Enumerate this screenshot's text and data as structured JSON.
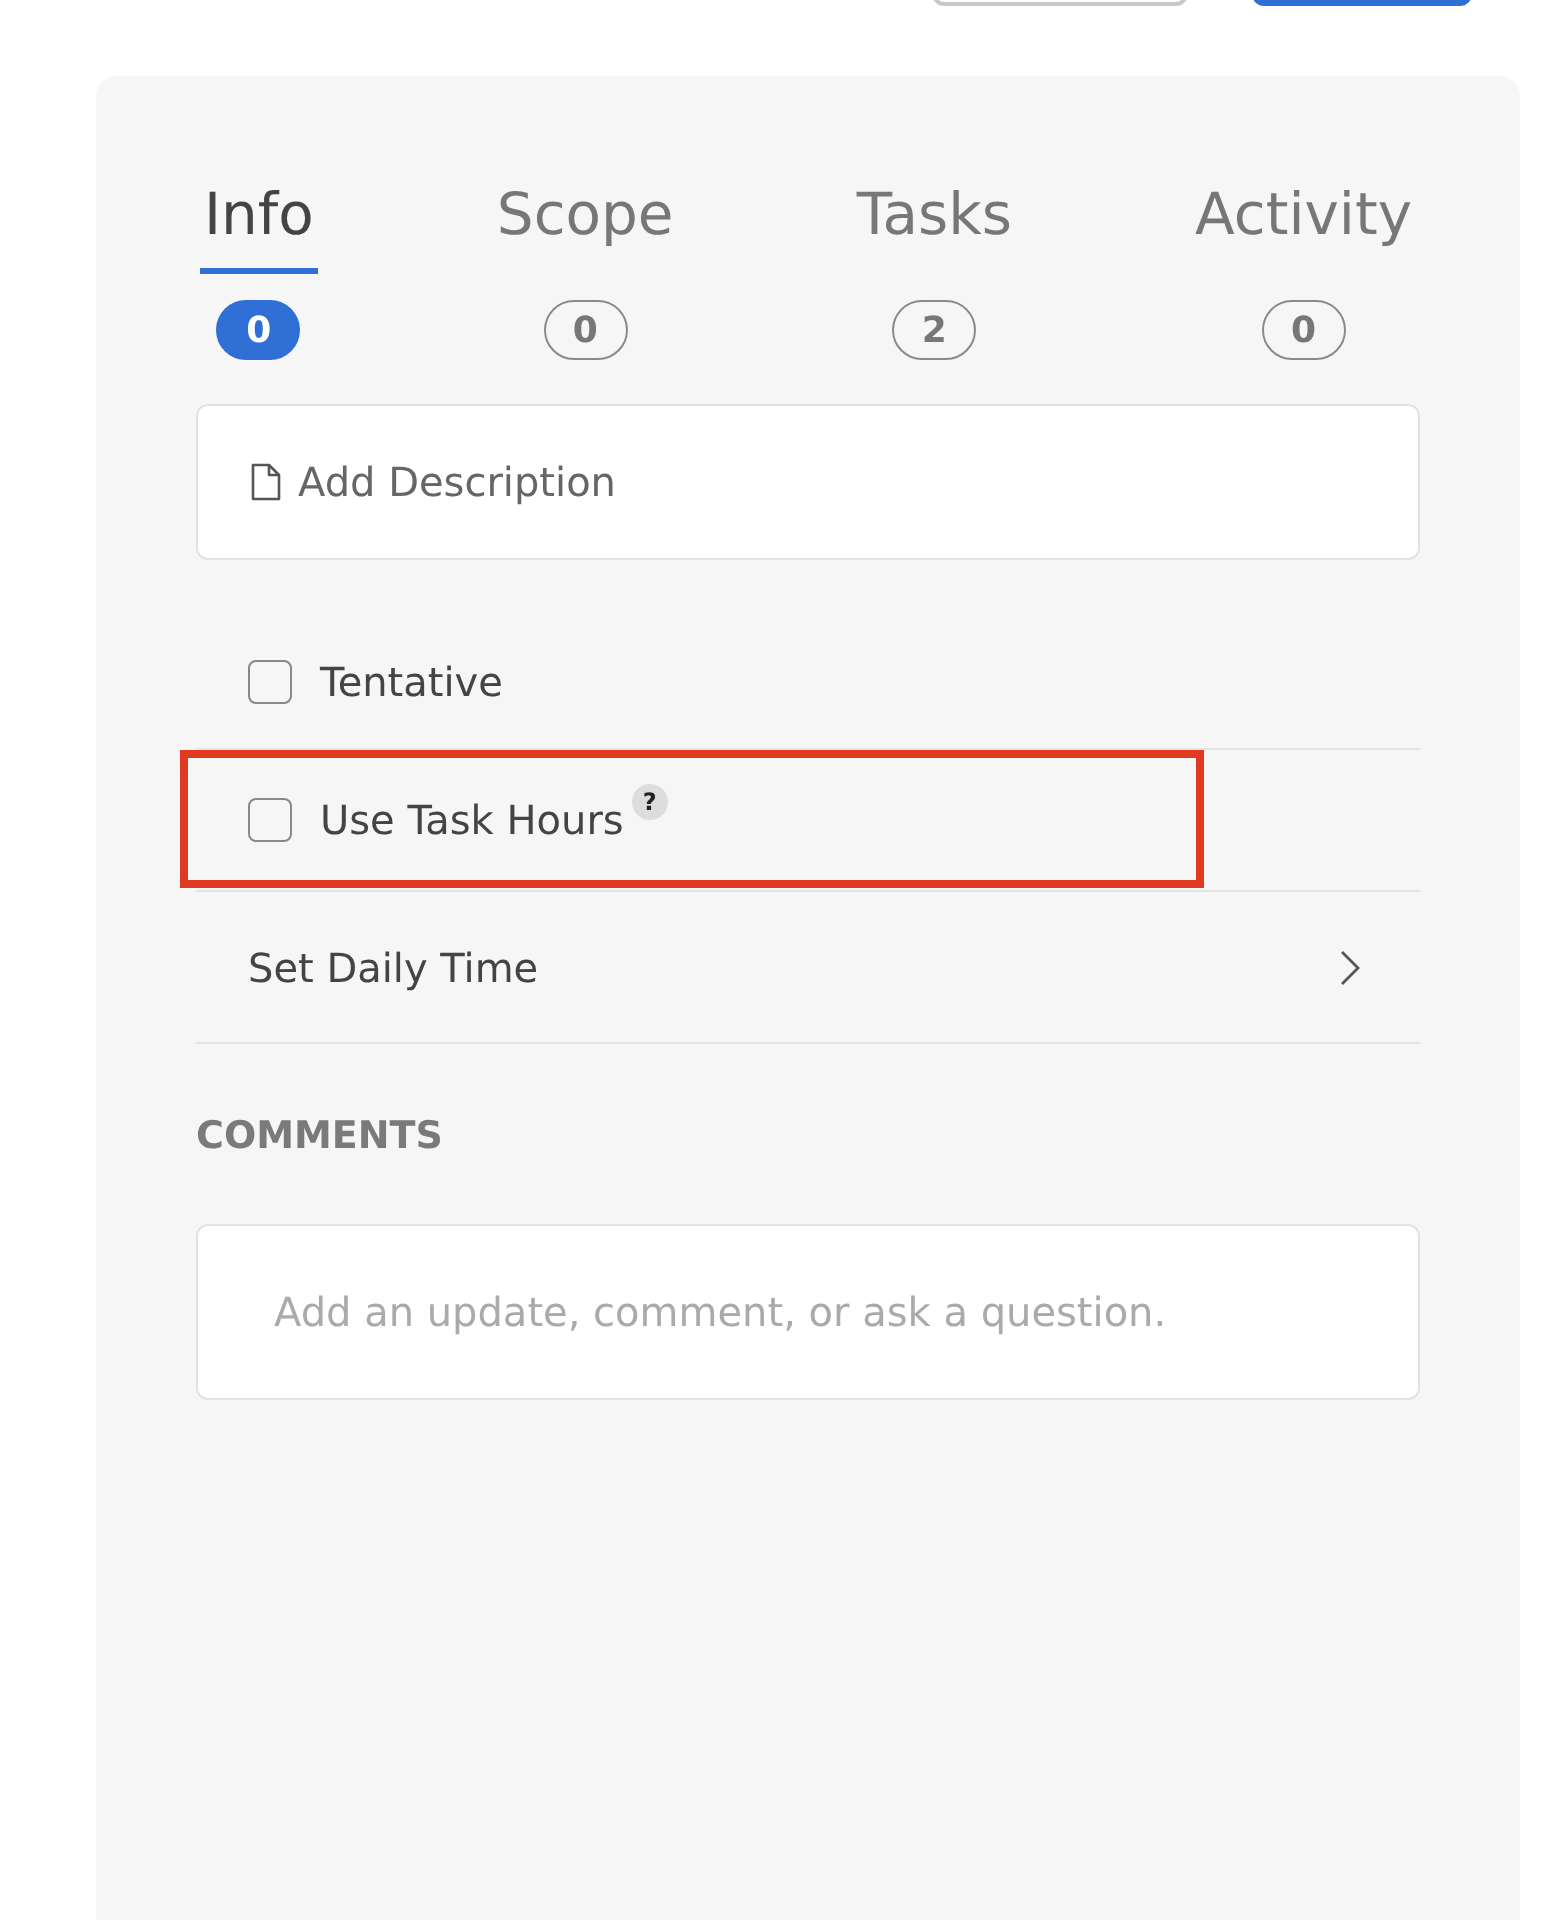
{
  "top_buttons": [
    {
      "kind": "outline"
    },
    {
      "kind": "primary"
    }
  ],
  "tabs": [
    {
      "label": "Info",
      "count": "0",
      "selected": true
    },
    {
      "label": "Scope",
      "count": "0",
      "selected": false
    },
    {
      "label": "Tasks",
      "count": "2",
      "selected": false
    },
    {
      "label": "Activity",
      "count": "0",
      "selected": false
    }
  ],
  "description": {
    "label": "Add Description"
  },
  "options": [
    {
      "kind": "checkbox",
      "label": "Tentative",
      "checked": false,
      "highlighted": false
    },
    {
      "kind": "checkbox",
      "label": "Use Task Hours",
      "help": "?",
      "checked": false,
      "highlighted": true
    },
    {
      "kind": "link",
      "label": "Set Daily Time"
    }
  ],
  "comments": {
    "heading": "COMMENTS",
    "placeholder": "Add an update, comment, or ask a question."
  }
}
